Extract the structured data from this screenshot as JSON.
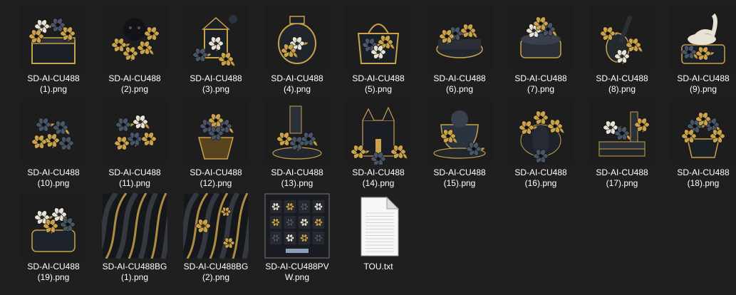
{
  "files": [
    {
      "line1": "SD-AI-CU488",
      "line2": "(1).png",
      "icon": "ornate-chest-icon",
      "kind": "chest"
    },
    {
      "line1": "SD-AI-CU488",
      "line2": "(2).png",
      "icon": "poodle-flowers-icon",
      "kind": "poodle"
    },
    {
      "line1": "SD-AI-CU488",
      "line2": "(3).png",
      "icon": "lantern-bird-icon",
      "kind": "lantern"
    },
    {
      "line1": "SD-AI-CU488",
      "line2": "(4).png",
      "icon": "jar-flower-icon",
      "kind": "jar"
    },
    {
      "line1": "SD-AI-CU488",
      "line2": "(5).png",
      "icon": "handbag-flowers-icon",
      "kind": "bag"
    },
    {
      "line1": "SD-AI-CU488",
      "line2": "(6).png",
      "icon": "rose-cake-icon",
      "kind": "cake"
    },
    {
      "line1": "SD-AI-CU488",
      "line2": "(7).png",
      "icon": "floral-cake-icon",
      "kind": "cake2"
    },
    {
      "line1": "SD-AI-CU488",
      "line2": "(8).png",
      "icon": "guitar-flowers-icon",
      "kind": "guitar"
    },
    {
      "line1": "SD-AI-CU488",
      "line2": "(9).png",
      "icon": "swan-box-icon",
      "kind": "swan"
    },
    {
      "line1": "SD-AI-CU488",
      "line2": "(10).png",
      "icon": "flower-cluster-icon",
      "kind": "cluster"
    },
    {
      "line1": "SD-AI-CU488",
      "line2": "(11).png",
      "icon": "flower-bouquet-icon",
      "kind": "cluster2"
    },
    {
      "line1": "SD-AI-CU488",
      "line2": "(12).png",
      "icon": "cupcake-flowers-icon",
      "kind": "cupcake"
    },
    {
      "line1": "SD-AI-CU488",
      "line2": "(13).png",
      "icon": "candle-flowers-icon",
      "kind": "candle"
    },
    {
      "line1": "SD-AI-CU488",
      "line2": "(14).png",
      "icon": "castle-icon",
      "kind": "castle"
    },
    {
      "line1": "SD-AI-CU488",
      "line2": "(15).png",
      "icon": "teacup-poodle-icon",
      "kind": "teacup"
    },
    {
      "line1": "SD-AI-CU488",
      "line2": "(16).png",
      "icon": "pumpkin-flowers-icon",
      "kind": "pumpkin"
    },
    {
      "line1": "SD-AI-CU488",
      "line2": "(17).png",
      "icon": "books-flowers-icon",
      "kind": "books"
    },
    {
      "line1": "SD-AI-CU488",
      "line2": "(18).png",
      "icon": "flower-pot-icon",
      "kind": "pot"
    },
    {
      "line1": "SD-AI-CU488",
      "line2": "(19).png",
      "icon": "flower-box-icon",
      "kind": "box"
    },
    {
      "line1": "SD-AI-CU488BG",
      "line2": "(1).png",
      "icon": "satin-background-icon",
      "kind": "bg1"
    },
    {
      "line1": "SD-AI-CU488BG",
      "line2": "(2).png",
      "icon": "satin-background-floral-icon",
      "kind": "bg2"
    },
    {
      "line1": "SD-AI-CU488PV",
      "line2": "W.png",
      "icon": "preview-collage-icon",
      "kind": "preview"
    },
    {
      "line1": "TOU.txt",
      "line2": "",
      "icon": "text-document-icon",
      "kind": "txt"
    }
  ],
  "colors": {
    "background": "#1f1f1f",
    "gold": "#c9a24a",
    "dark": "#1b1f26",
    "slate": "#4a5566",
    "cream": "#e8e2d4"
  }
}
